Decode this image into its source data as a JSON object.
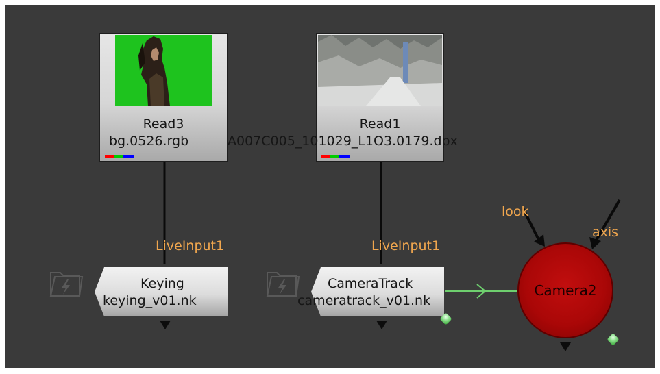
{
  "nodes": {
    "read3": {
      "name": "Read3",
      "file": "bg.0526.rgb"
    },
    "read1": {
      "name": "Read1",
      "file": "A007C005_101029_L1O3.0179.dpx"
    },
    "keying": {
      "name": "Keying",
      "file": "keying_v01.nk",
      "input_label": "LiveInput1"
    },
    "cameratrack": {
      "name": "CameraTrack",
      "file": "cameratrack_v01.nk",
      "input_label": "LiveInput1"
    },
    "camera2": {
      "name": "Camera2",
      "input_look": "look",
      "input_axis": "axis"
    }
  },
  "icons": {
    "folder": "folder-lightning-icon",
    "connection_dot": "connection-dot-icon",
    "output_arrow": "output-arrow-icon"
  },
  "colors": {
    "graph_bg": "#3a3a3a",
    "input_label": "#f0a64e",
    "camera_node": "#aa0707",
    "link_green": "#6ecf6e",
    "channel_red": "#ff0000",
    "channel_green": "#00cc00",
    "channel_blue": "#0000ff"
  }
}
